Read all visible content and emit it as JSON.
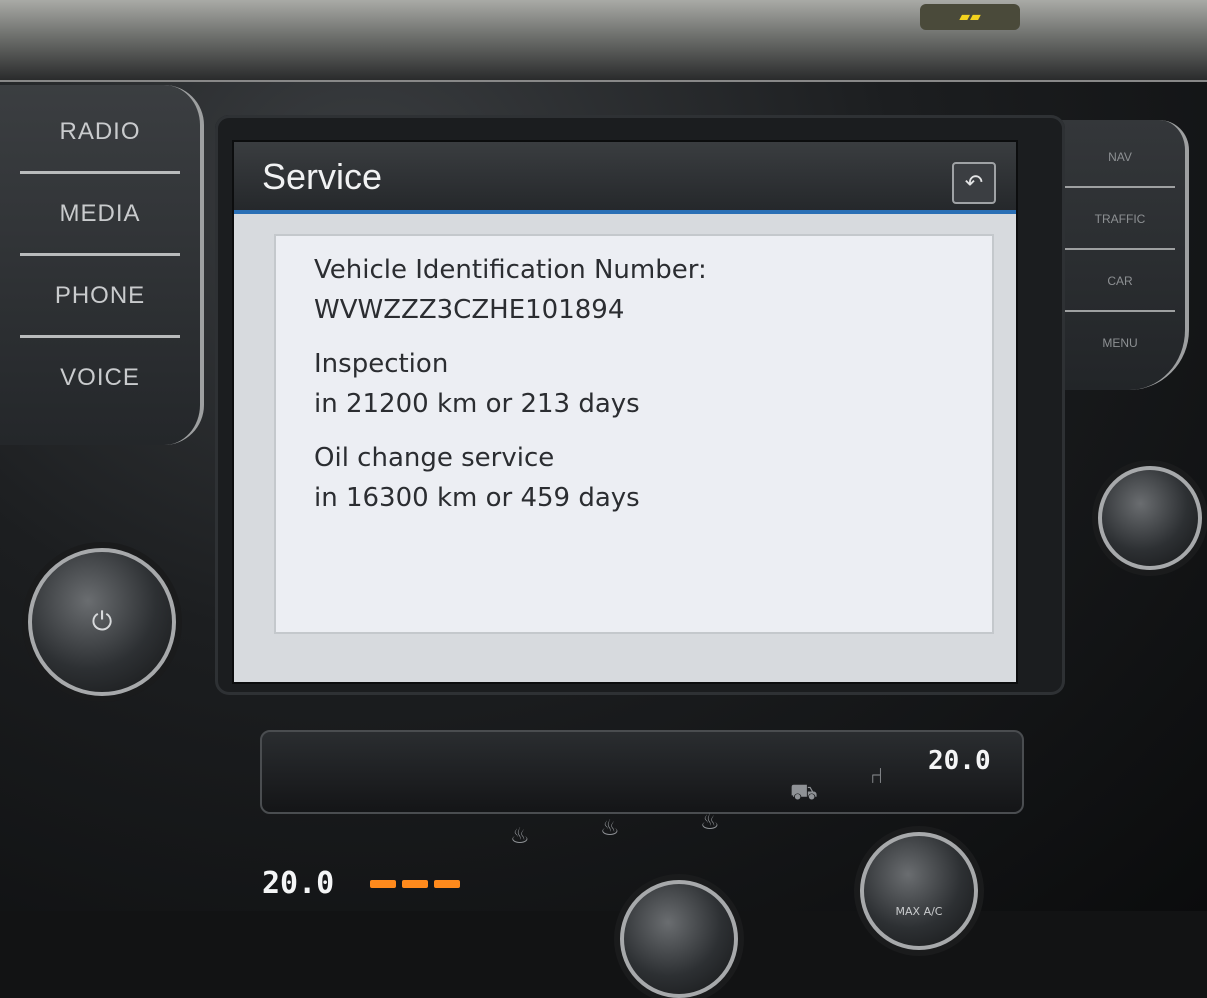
{
  "screen": {
    "title": "Service",
    "back_icon": "back-arrow-icon",
    "vin_label": "Vehicle Identification Number:",
    "vin_value": "WVWZZZ3CZHE101894",
    "inspection_label": "Inspection",
    "inspection_due": "in 21200 km or 213 days",
    "oil_label": "Oil change service",
    "oil_due": "in 16300 km or 459 days",
    "accent_color": "#2a6fb5"
  },
  "hardware_buttons_left": [
    {
      "label": "RADIO"
    },
    {
      "label": "MEDIA"
    },
    {
      "label": "PHONE"
    },
    {
      "label": "VOICE"
    }
  ],
  "hardware_buttons_right": [
    {
      "label": "NAV"
    },
    {
      "label": "TRAFFIC"
    },
    {
      "label": "CAR"
    },
    {
      "label": "MENU"
    }
  ],
  "climate": {
    "temp_right": "20.0",
    "temp_left": "20.0",
    "ac_label": "MAX A/C"
  }
}
